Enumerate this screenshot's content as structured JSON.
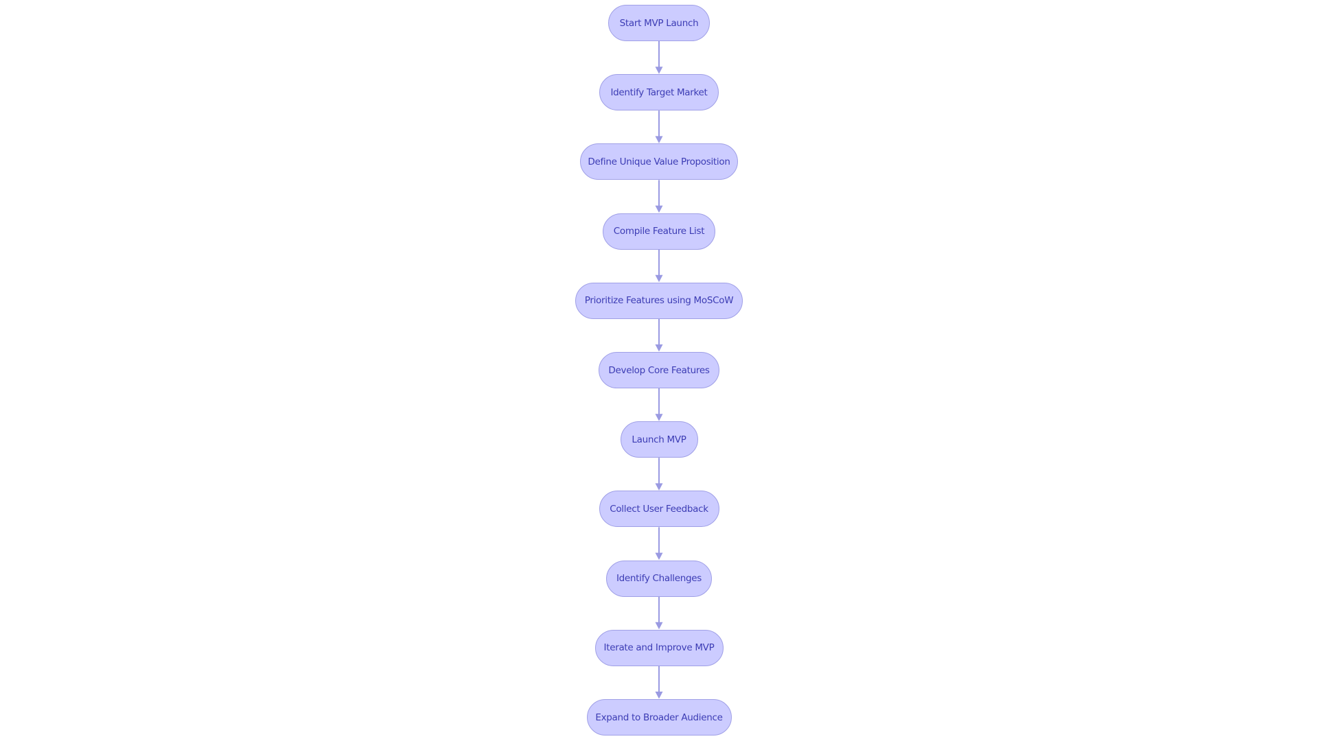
{
  "diagram": {
    "type": "flowchart",
    "direction": "top-to-bottom",
    "colors": {
      "node_fill": "#ccccff",
      "node_border": "#9f9fe6",
      "node_text": "#3c3cb4",
      "edge": "#9a9ae2"
    },
    "nodes": [
      {
        "id": "n1",
        "label": "Start MVP Launch"
      },
      {
        "id": "n2",
        "label": "Identify Target Market"
      },
      {
        "id": "n3",
        "label": "Define Unique Value Proposition"
      },
      {
        "id": "n4",
        "label": "Compile Feature List"
      },
      {
        "id": "n5",
        "label": "Prioritize Features using MoSCoW"
      },
      {
        "id": "n6",
        "label": "Develop Core Features"
      },
      {
        "id": "n7",
        "label": "Launch MVP"
      },
      {
        "id": "n8",
        "label": "Collect User Feedback"
      },
      {
        "id": "n9",
        "label": "Identify Challenges"
      },
      {
        "id": "n10",
        "label": "Iterate and Improve MVP"
      },
      {
        "id": "n11",
        "label": "Expand to Broader Audience"
      }
    ],
    "edges": [
      {
        "from": "n1",
        "to": "n2"
      },
      {
        "from": "n2",
        "to": "n3"
      },
      {
        "from": "n3",
        "to": "n4"
      },
      {
        "from": "n4",
        "to": "n5"
      },
      {
        "from": "n5",
        "to": "n6"
      },
      {
        "from": "n6",
        "to": "n7"
      },
      {
        "from": "n7",
        "to": "n8"
      },
      {
        "from": "n8",
        "to": "n9"
      },
      {
        "from": "n9",
        "to": "n10"
      },
      {
        "from": "n10",
        "to": "n11"
      }
    ]
  }
}
